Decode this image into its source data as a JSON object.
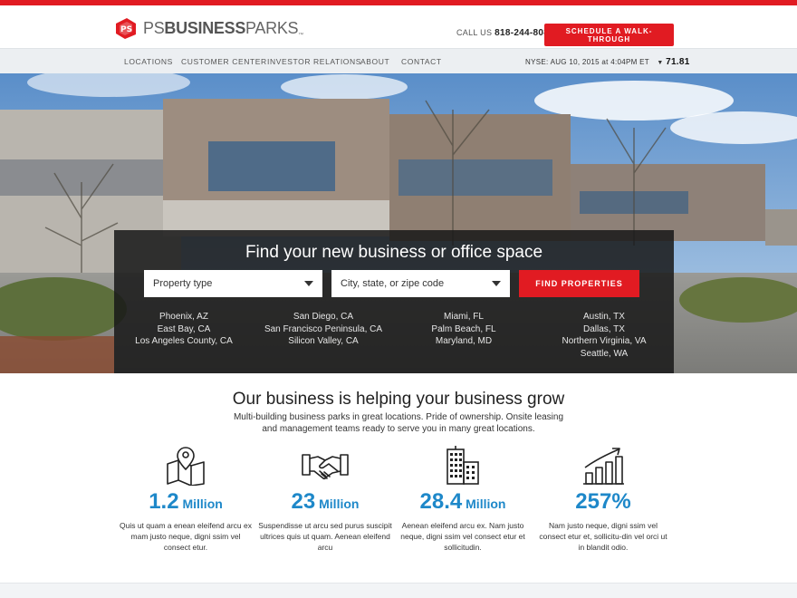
{
  "brand": {
    "name_ps": "PS",
    "name_business": "BUSINESS",
    "name_parks": "PARKS",
    "tm": "™",
    "accent_color": "#e11b22",
    "link_color": "#1e88c9"
  },
  "header": {
    "call_label": "CALL US",
    "phone": "818-244-8080",
    "cta_label": "SCHEDULE A WALK-THROUGH"
  },
  "nav": {
    "items": [
      {
        "label": "LOCATIONS"
      },
      {
        "label": "CUSTOMER CENTER"
      },
      {
        "label": "INVESTOR RELATIONS"
      },
      {
        "label": "ABOUT"
      },
      {
        "label": "CONTACT"
      }
    ],
    "ticker_label": "NYSE: AUG 10, 2015 at 4:04PM ET",
    "ticker_arrow": "▼",
    "ticker_price": "71.81"
  },
  "search": {
    "title": "Find your new business or office space",
    "property_type_placeholder": "Property type",
    "location_placeholder": "City, state, or zipe code",
    "find_label": "FIND PROPERTIES",
    "location_columns": [
      [
        "Phoenix, AZ",
        "East Bay, CA",
        "Los Angeles County, CA"
      ],
      [
        "San Diego, CA",
        "San Francisco Peninsula, CA",
        "Silicon Valley, CA"
      ],
      [
        "Miami, FL",
        "Palm Beach, FL",
        "Maryland, MD"
      ],
      [
        "Austin, TX",
        "Dallas, TX",
        "Northern Virginia, VA",
        "Seattle, WA"
      ]
    ]
  },
  "intro": {
    "title": "Our business is helping your business grow",
    "subtitle": "Multi-building business parks in great locations. Pride of ownership. Onsite leasing and management teams ready to serve you in many great locations."
  },
  "stats": [
    {
      "icon": "map-pin-icon",
      "value": "1.2",
      "unit": " Million",
      "desc": "Quis ut quam a enean eleifend arcu ex mam justo neque, digni ssim vel consect etur."
    },
    {
      "icon": "handshake-icon",
      "value": "23",
      "unit": " Million",
      "desc": "Suspendisse ut arcu sed purus suscipit ultrices quis ut quam. Aenean eleifend arcu"
    },
    {
      "icon": "buildings-icon",
      "value": "28.4",
      "unit": " Million",
      "desc": "Aenean eleifend arcu ex. Nam justo neque, digni ssim vel consect etur et sollicitudin."
    },
    {
      "icon": "growth-chart-icon",
      "value": "257%",
      "unit": "",
      "desc": "Nam justo neque, digni ssim vel consect etur et, sollicitu-din vel orci ut in blandit odio."
    }
  ]
}
